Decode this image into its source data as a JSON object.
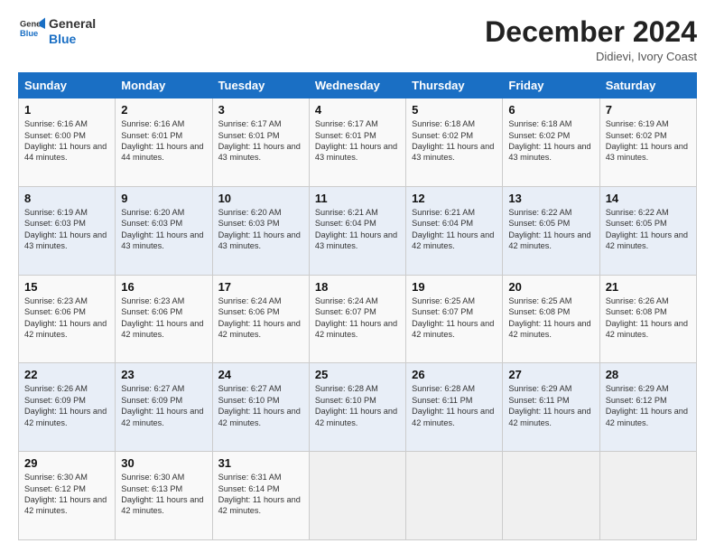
{
  "logo": {
    "general": "General",
    "blue": "Blue"
  },
  "header": {
    "month": "December 2024",
    "location": "Didievi, Ivory Coast"
  },
  "weekdays": [
    "Sunday",
    "Monday",
    "Tuesday",
    "Wednesday",
    "Thursday",
    "Friday",
    "Saturday"
  ],
  "weeks": [
    [
      {
        "day": "1",
        "sunrise": "6:16 AM",
        "sunset": "6:00 PM",
        "daylight": "11 hours and 44 minutes."
      },
      {
        "day": "2",
        "sunrise": "6:16 AM",
        "sunset": "6:01 PM",
        "daylight": "11 hours and 44 minutes."
      },
      {
        "day": "3",
        "sunrise": "6:17 AM",
        "sunset": "6:01 PM",
        "daylight": "11 hours and 43 minutes."
      },
      {
        "day": "4",
        "sunrise": "6:17 AM",
        "sunset": "6:01 PM",
        "daylight": "11 hours and 43 minutes."
      },
      {
        "day": "5",
        "sunrise": "6:18 AM",
        "sunset": "6:02 PM",
        "daylight": "11 hours and 43 minutes."
      },
      {
        "day": "6",
        "sunrise": "6:18 AM",
        "sunset": "6:02 PM",
        "daylight": "11 hours and 43 minutes."
      },
      {
        "day": "7",
        "sunrise": "6:19 AM",
        "sunset": "6:02 PM",
        "daylight": "11 hours and 43 minutes."
      }
    ],
    [
      {
        "day": "8",
        "sunrise": "6:19 AM",
        "sunset": "6:03 PM",
        "daylight": "11 hours and 43 minutes."
      },
      {
        "day": "9",
        "sunrise": "6:20 AM",
        "sunset": "6:03 PM",
        "daylight": "11 hours and 43 minutes."
      },
      {
        "day": "10",
        "sunrise": "6:20 AM",
        "sunset": "6:03 PM",
        "daylight": "11 hours and 43 minutes."
      },
      {
        "day": "11",
        "sunrise": "6:21 AM",
        "sunset": "6:04 PM",
        "daylight": "11 hours and 43 minutes."
      },
      {
        "day": "12",
        "sunrise": "6:21 AM",
        "sunset": "6:04 PM",
        "daylight": "11 hours and 42 minutes."
      },
      {
        "day": "13",
        "sunrise": "6:22 AM",
        "sunset": "6:05 PM",
        "daylight": "11 hours and 42 minutes."
      },
      {
        "day": "14",
        "sunrise": "6:22 AM",
        "sunset": "6:05 PM",
        "daylight": "11 hours and 42 minutes."
      }
    ],
    [
      {
        "day": "15",
        "sunrise": "6:23 AM",
        "sunset": "6:06 PM",
        "daylight": "11 hours and 42 minutes."
      },
      {
        "day": "16",
        "sunrise": "6:23 AM",
        "sunset": "6:06 PM",
        "daylight": "11 hours and 42 minutes."
      },
      {
        "day": "17",
        "sunrise": "6:24 AM",
        "sunset": "6:06 PM",
        "daylight": "11 hours and 42 minutes."
      },
      {
        "day": "18",
        "sunrise": "6:24 AM",
        "sunset": "6:07 PM",
        "daylight": "11 hours and 42 minutes."
      },
      {
        "day": "19",
        "sunrise": "6:25 AM",
        "sunset": "6:07 PM",
        "daylight": "11 hours and 42 minutes."
      },
      {
        "day": "20",
        "sunrise": "6:25 AM",
        "sunset": "6:08 PM",
        "daylight": "11 hours and 42 minutes."
      },
      {
        "day": "21",
        "sunrise": "6:26 AM",
        "sunset": "6:08 PM",
        "daylight": "11 hours and 42 minutes."
      }
    ],
    [
      {
        "day": "22",
        "sunrise": "6:26 AM",
        "sunset": "6:09 PM",
        "daylight": "11 hours and 42 minutes."
      },
      {
        "day": "23",
        "sunrise": "6:27 AM",
        "sunset": "6:09 PM",
        "daylight": "11 hours and 42 minutes."
      },
      {
        "day": "24",
        "sunrise": "6:27 AM",
        "sunset": "6:10 PM",
        "daylight": "11 hours and 42 minutes."
      },
      {
        "day": "25",
        "sunrise": "6:28 AM",
        "sunset": "6:10 PM",
        "daylight": "11 hours and 42 minutes."
      },
      {
        "day": "26",
        "sunrise": "6:28 AM",
        "sunset": "6:11 PM",
        "daylight": "11 hours and 42 minutes."
      },
      {
        "day": "27",
        "sunrise": "6:29 AM",
        "sunset": "6:11 PM",
        "daylight": "11 hours and 42 minutes."
      },
      {
        "day": "28",
        "sunrise": "6:29 AM",
        "sunset": "6:12 PM",
        "daylight": "11 hours and 42 minutes."
      }
    ],
    [
      {
        "day": "29",
        "sunrise": "6:30 AM",
        "sunset": "6:12 PM",
        "daylight": "11 hours and 42 minutes."
      },
      {
        "day": "30",
        "sunrise": "6:30 AM",
        "sunset": "6:13 PM",
        "daylight": "11 hours and 42 minutes."
      },
      {
        "day": "31",
        "sunrise": "6:31 AM",
        "sunset": "6:14 PM",
        "daylight": "11 hours and 42 minutes."
      },
      null,
      null,
      null,
      null
    ]
  ]
}
